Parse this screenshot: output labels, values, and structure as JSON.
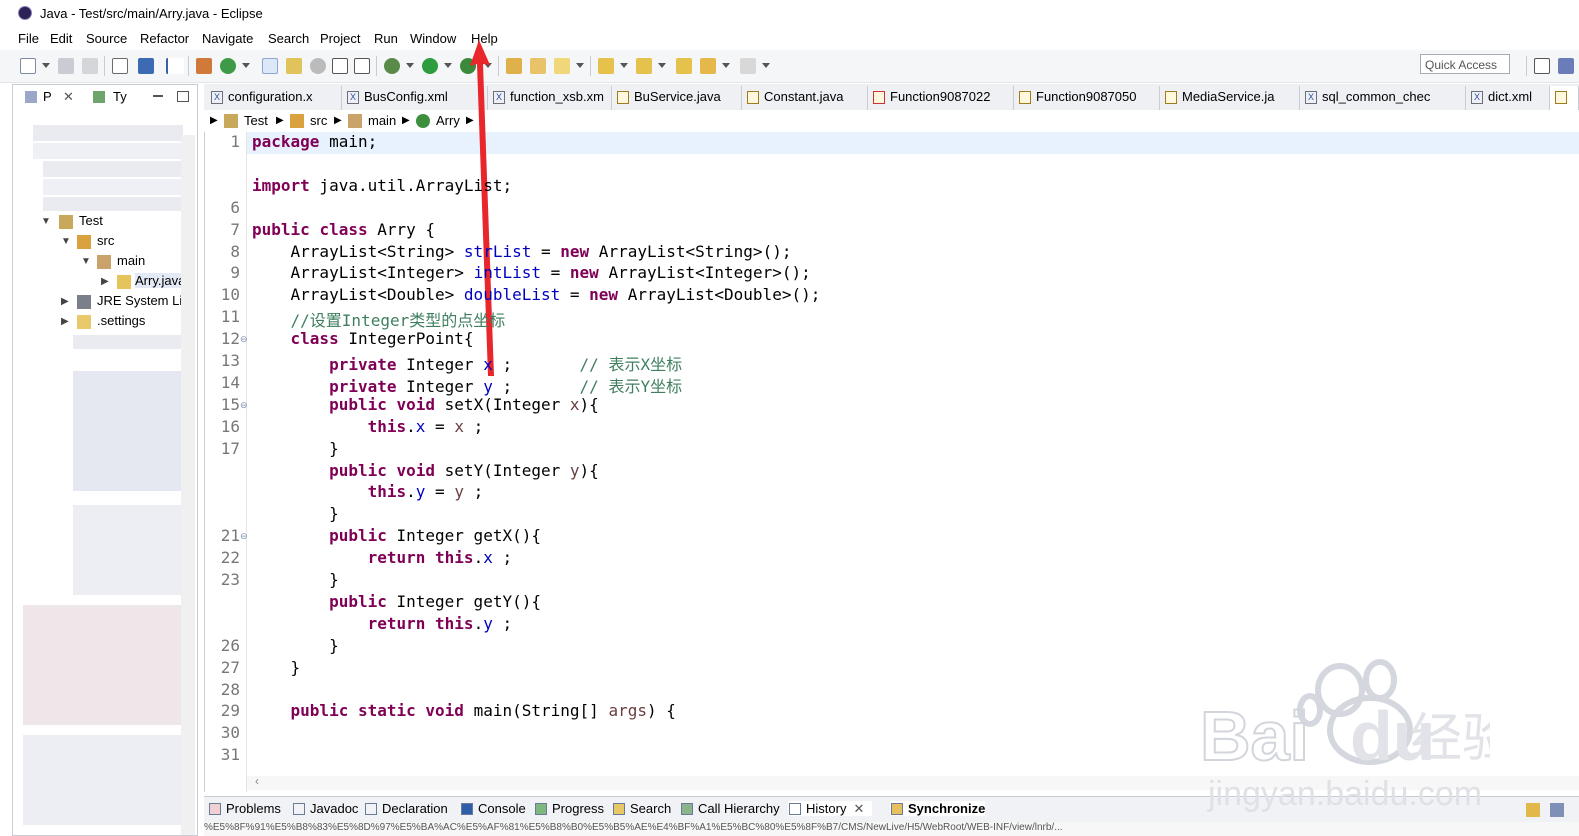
{
  "window": {
    "title": "Java - Test/src/main/Arry.java - Eclipse"
  },
  "menu": [
    "File",
    "Edit",
    "Source",
    "Refactor",
    "Navigate",
    "Search",
    "Project",
    "Run",
    "Window",
    "Help"
  ],
  "toolbar": {
    "quick_access_placeholder": "Quick Access"
  },
  "left_panel": {
    "tabs": [
      "P",
      "Ty"
    ],
    "tree": [
      {
        "label": "Test"
      },
      {
        "label": "src"
      },
      {
        "label": "main"
      },
      {
        "label": "Arry.java"
      },
      {
        "label": "JRE System Lib"
      },
      {
        "label": ".settings"
      }
    ]
  },
  "editor_tabs": [
    "configuration.x",
    "BusConfig.xml",
    "function_xsb.xm",
    "BuService.java",
    "Constant.java",
    "Function9087022",
    "Function9087050",
    "MediaService.ja",
    "sql_common_chec",
    "dict.xml"
  ],
  "breadcrumb": [
    "Test",
    "src",
    "main",
    "Arry"
  ],
  "code_lines": [
    {
      "n": "1",
      "t": "package main;"
    },
    {
      "n": "",
      "t": ""
    },
    {
      "n": "",
      "t": "import java.util.ArrayList;"
    },
    {
      "n": "6",
      "t": ""
    },
    {
      "n": "7",
      "t": "public class Arry {"
    },
    {
      "n": "8",
      "t": "    ArrayList<String> strList = new ArrayList<String>();"
    },
    {
      "n": "9",
      "t": "    ArrayList<Integer> intList = new ArrayList<Integer>();"
    },
    {
      "n": "10",
      "t": "    ArrayList<Double> doubleList = new ArrayList<Double>();"
    },
    {
      "n": "11",
      "t": "    //设置Integer类型的点坐标"
    },
    {
      "n": "12",
      "t": "    class IntegerPoint{"
    },
    {
      "n": "13",
      "t": "        private Integer x ;       // 表示X坐标"
    },
    {
      "n": "14",
      "t": "        private Integer y ;       // 表示Y坐标"
    },
    {
      "n": "15",
      "t": "        public void setX(Integer x){"
    },
    {
      "n": "16",
      "t": "            this.x = x ;"
    },
    {
      "n": "17",
      "t": "        }"
    },
    {
      "n": "",
      "t": "        public void setY(Integer y){"
    },
    {
      "n": "",
      "t": "            this.y = y ;"
    },
    {
      "n": "",
      "t": "        }"
    },
    {
      "n": "21",
      "t": "        public Integer getX(){"
    },
    {
      "n": "22",
      "t": "            return this.x ;"
    },
    {
      "n": "23",
      "t": "        }"
    },
    {
      "n": "",
      "t": "        public Integer getY(){"
    },
    {
      "n": "",
      "t": "            return this.y ;"
    },
    {
      "n": "26",
      "t": "        }"
    },
    {
      "n": "27",
      "t": "    }"
    },
    {
      "n": "28",
      "t": ""
    },
    {
      "n": "29",
      "t": "    public static void main(String[] args) {"
    },
    {
      "n": "30",
      "t": ""
    },
    {
      "n": "31",
      "t": ""
    }
  ],
  "bottom_tabs": [
    "Problems",
    "Javadoc",
    "Declaration",
    "Console",
    "Progress",
    "Search",
    "Call Hierarchy",
    "History",
    "Synchronize"
  ],
  "status_text": "%E5%8F%91%E5%B8%83%E5%8D%97%E5%BA%AC%E5%AF%81%E5%B8%B0%E5%B5%AE%E4%BF%A1%E5%BC%80%E5%8F%B7/CMS/NewLive/H5/WebRoot/WEB-INF/view/lnrb/..."
}
